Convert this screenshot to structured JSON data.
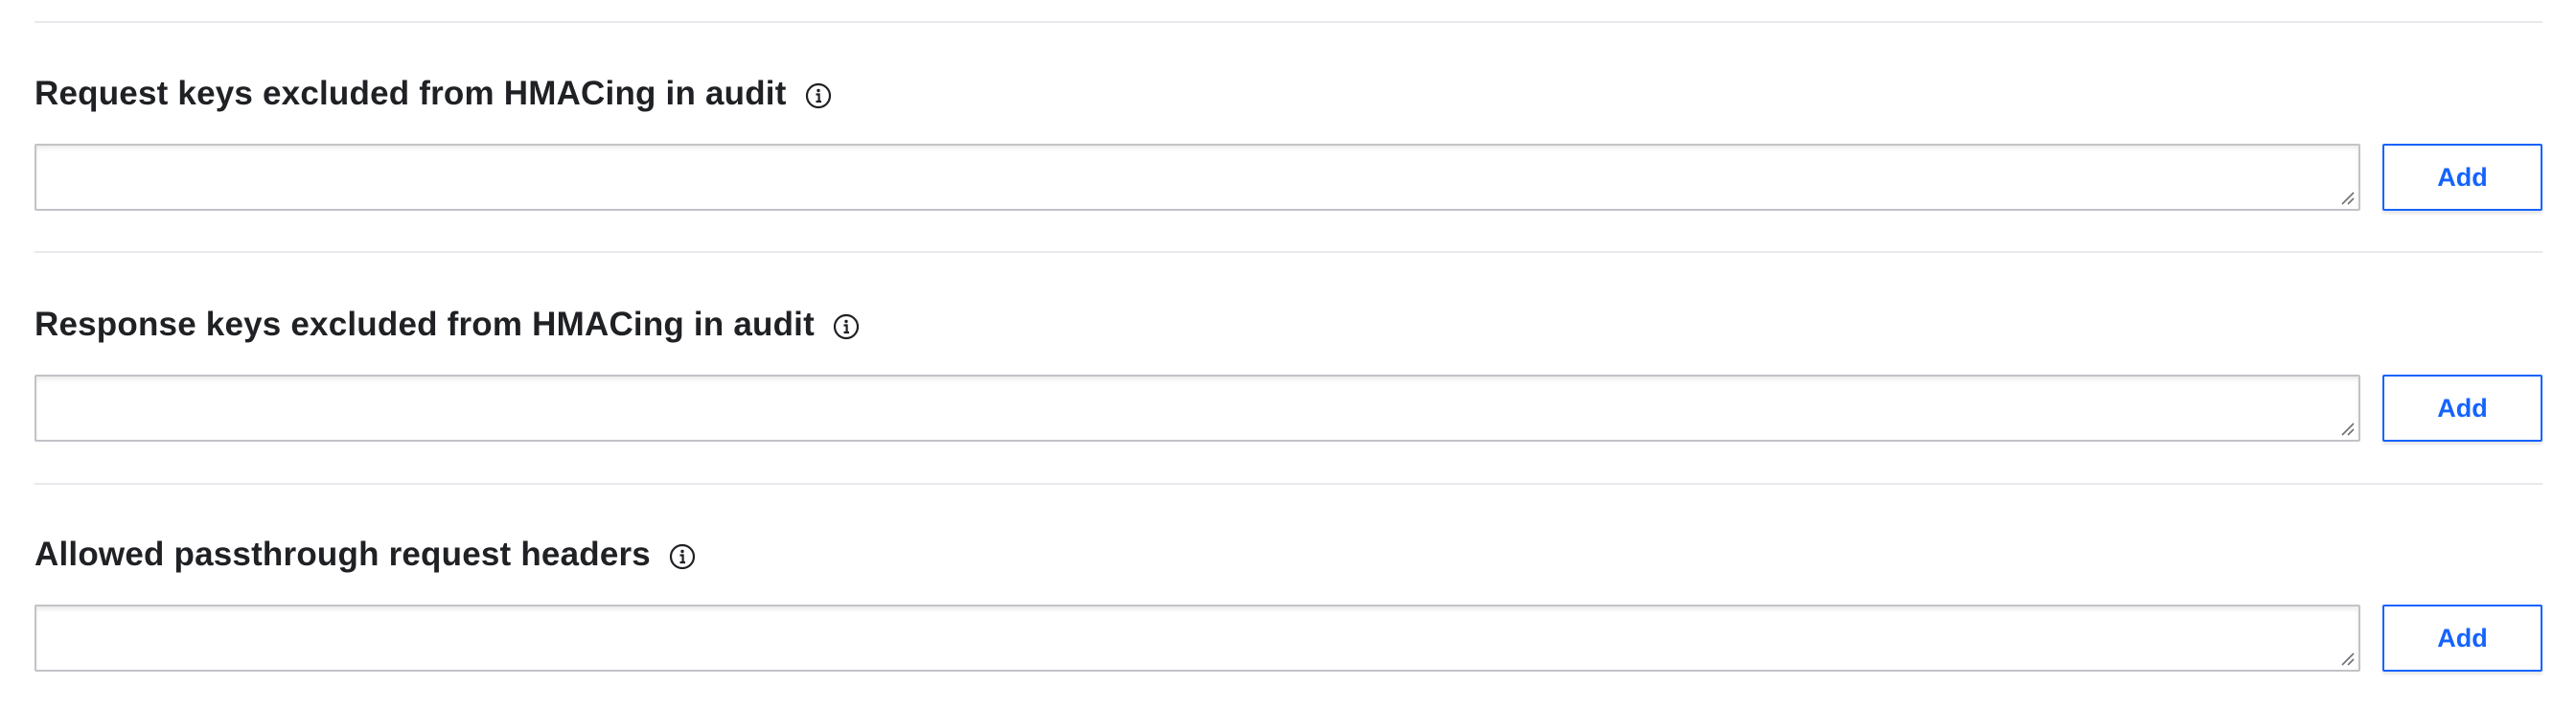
{
  "sections": [
    {
      "label": "Request keys excluded from HMACing in audit",
      "info_icon": "info-icon",
      "input_value": "",
      "button_label": "Add"
    },
    {
      "label": "Response keys excluded from HMACing in audit",
      "info_icon": "info-icon",
      "input_value": "",
      "button_label": "Add"
    },
    {
      "label": "Allowed passthrough request headers",
      "info_icon": "info-icon",
      "input_value": "",
      "button_label": "Add"
    }
  ],
  "colors": {
    "accent": "#1563ff",
    "label_text": "#1f2124",
    "field_border": "#c2c3c7",
    "divider": "#e8e9ed"
  }
}
